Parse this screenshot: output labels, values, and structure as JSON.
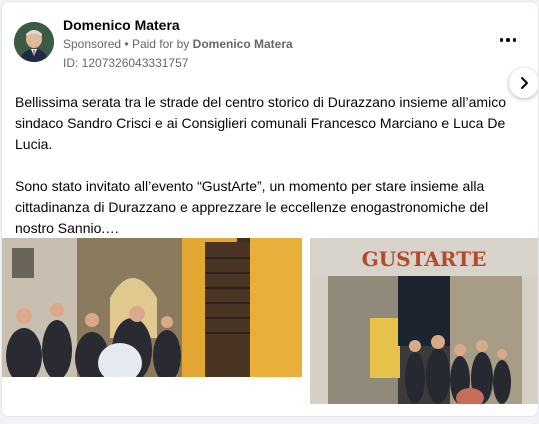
{
  "post": {
    "author": "Domenico Matera",
    "sponsored": "Sponsored",
    "separator": "•",
    "paid_for_by": "Paid for by",
    "payer": "Domenico Matera",
    "ad_id": "ID: 1207326043331757",
    "paragraph1": "Bellissima serata tra le strade del centro storico di Durazzano insieme all’amico sindaco Sandro Crisci e ai Consiglieri comunali Francesco Marciano e Luca De Lucia.",
    "paragraph2": "Sono stato invitato all’evento “GustArte”, un momento per stare insieme alla cittadinanza di Durazzano e apprezzare le eccellenze enogastronomiche del nostro Sannio.…"
  },
  "carousel": {
    "sign_text": "GUSTARTE"
  },
  "icons": {
    "more": "more-options-icon",
    "next": "chevron-right-icon"
  }
}
